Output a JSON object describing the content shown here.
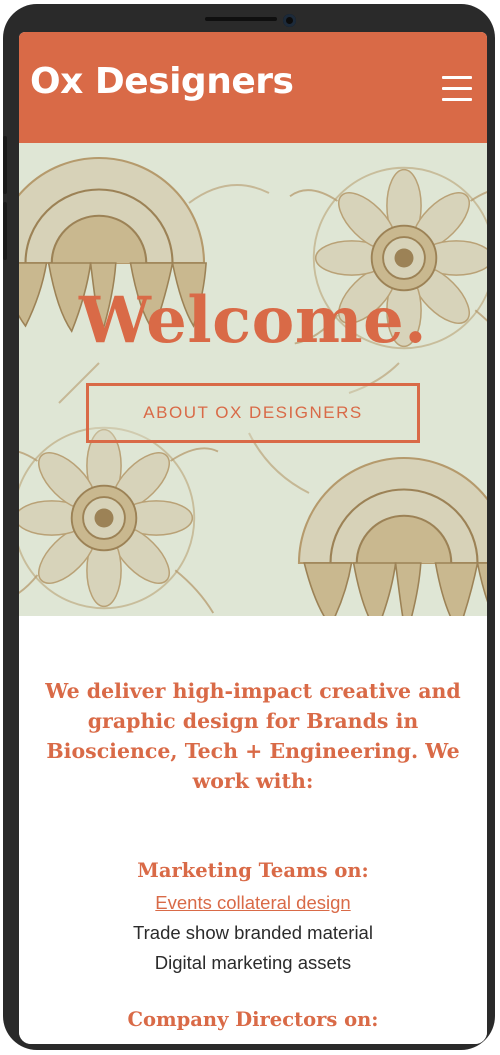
{
  "header": {
    "logo_text": "Ox Designers",
    "menu_icon": "hamburger-menu-icon"
  },
  "hero": {
    "title": "Welcome.",
    "button_label": "ABOUT OX DESIGNERS"
  },
  "content": {
    "intro": "We deliver high-impact creative and graphic design for Brands in Bioscience, Tech + Engineering. We work with:",
    "sections": [
      {
        "heading": "Marketing Teams on:",
        "items": [
          {
            "label": "Events collateral design",
            "link": true
          },
          {
            "label": "Trade show branded material",
            "link": false
          },
          {
            "label": "Digital marketing assets",
            "link": false
          }
        ]
      },
      {
        "heading": "Company Directors on:",
        "items": []
      }
    ]
  },
  "colors": {
    "brand": "#d96a47",
    "hero_background": "#dfe6d5",
    "illustration": "#b59a6c",
    "device_frame": "#2a2a2a"
  }
}
